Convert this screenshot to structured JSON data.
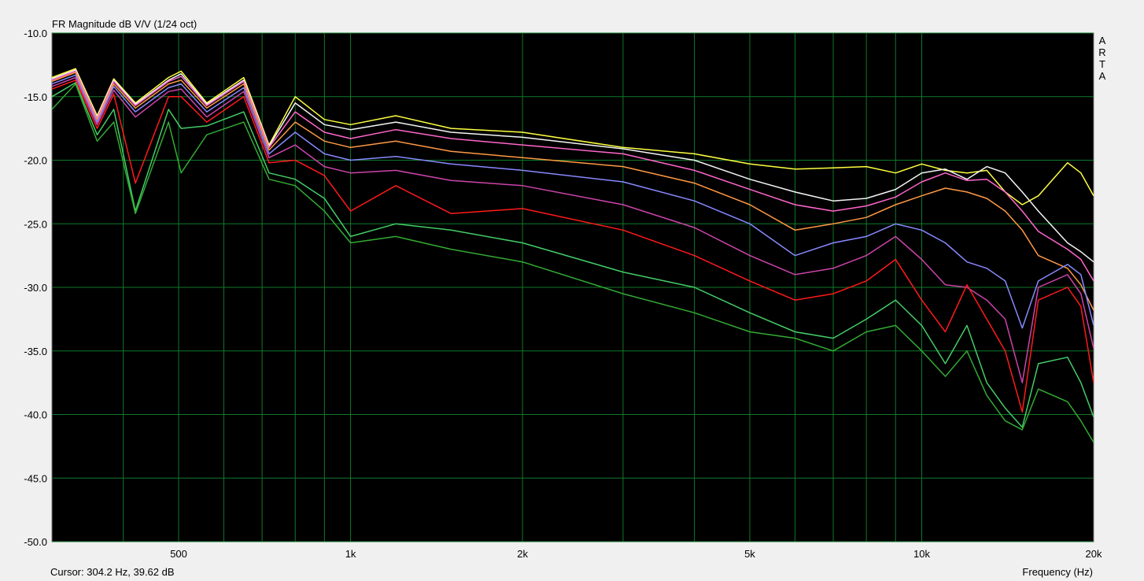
{
  "chart_data": {
    "type": "line",
    "title": "FR Magnitude dB V/V (1/24 oct)",
    "xlabel": "Frequency (Hz)",
    "ylabel": "",
    "x_scale": "log",
    "xlim": [
      300,
      20000
    ],
    "ylim": [
      -50,
      -10
    ],
    "grid": true,
    "y_ticks": [
      "-10.0",
      "-15.0",
      "-20.0",
      "-25.0",
      "-30.0",
      "-35.0",
      "-40.0",
      "-45.0",
      "-50.0"
    ],
    "x_tick_labels": [
      {
        "value": 500,
        "label": "500"
      },
      {
        "value": 1000,
        "label": "1k"
      },
      {
        "value": 2000,
        "label": "2k"
      },
      {
        "value": 5000,
        "label": "5k"
      },
      {
        "value": 10000,
        "label": "10k"
      },
      {
        "value": 20000,
        "label": "20k"
      }
    ],
    "x_minor_grid": [
      400,
      500,
      600,
      700,
      800,
      900,
      1000,
      2000,
      3000,
      4000,
      5000,
      6000,
      7000,
      8000,
      9000,
      10000
    ],
    "brand": [
      "A",
      "R",
      "T",
      "A"
    ],
    "cursor": "Cursor: 304.2 Hz, 39.62 dB",
    "series": [
      {
        "color": "#ffff40",
        "points": [
          [
            300,
            -13.5
          ],
          [
            330,
            -12.8
          ],
          [
            360,
            -16.5
          ],
          [
            385,
            -13.6
          ],
          [
            420,
            -15.5
          ],
          [
            480,
            -13.5
          ],
          [
            505,
            -13.0
          ],
          [
            560,
            -15.5
          ],
          [
            650,
            -13.5
          ],
          [
            720,
            -18.8
          ],
          [
            800,
            -15.0
          ],
          [
            900,
            -16.8
          ],
          [
            1000,
            -17.2
          ],
          [
            1200,
            -16.5
          ],
          [
            1500,
            -17.5
          ],
          [
            2000,
            -17.8
          ],
          [
            3000,
            -19.0
          ],
          [
            4000,
            -19.5
          ],
          [
            5000,
            -20.3
          ],
          [
            6000,
            -20.7
          ],
          [
            7000,
            -20.6
          ],
          [
            8000,
            -20.5
          ],
          [
            9000,
            -21.0
          ],
          [
            10000,
            -20.3
          ],
          [
            11000,
            -20.8
          ],
          [
            12000,
            -21.0
          ],
          [
            13000,
            -20.8
          ],
          [
            14000,
            -22.5
          ],
          [
            15000,
            -23.5
          ],
          [
            16000,
            -22.8
          ],
          [
            18000,
            -20.2
          ],
          [
            19000,
            -21.0
          ],
          [
            20000,
            -22.8
          ]
        ]
      },
      {
        "color": "#f5f5f5",
        "points": [
          [
            300,
            -13.6
          ],
          [
            330,
            -12.9
          ],
          [
            360,
            -16.6
          ],
          [
            385,
            -13.7
          ],
          [
            420,
            -15.6
          ],
          [
            480,
            -13.7
          ],
          [
            505,
            -13.2
          ],
          [
            560,
            -15.6
          ],
          [
            650,
            -13.7
          ],
          [
            720,
            -18.9
          ],
          [
            800,
            -15.5
          ],
          [
            900,
            -17.2
          ],
          [
            1000,
            -17.6
          ],
          [
            1200,
            -17.0
          ],
          [
            1500,
            -17.8
          ],
          [
            2000,
            -18.2
          ],
          [
            3000,
            -19.1
          ],
          [
            4000,
            -20.0
          ],
          [
            5000,
            -21.5
          ],
          [
            6000,
            -22.5
          ],
          [
            7000,
            -23.2
          ],
          [
            8000,
            -23.0
          ],
          [
            9000,
            -22.3
          ],
          [
            10000,
            -21.0
          ],
          [
            11000,
            -20.7
          ],
          [
            12000,
            -21.5
          ],
          [
            13000,
            -20.5
          ],
          [
            14000,
            -21.0
          ],
          [
            15000,
            -22.5
          ],
          [
            16000,
            -24.0
          ],
          [
            18000,
            -26.5
          ],
          [
            19000,
            -27.2
          ],
          [
            20000,
            -28.0
          ]
        ]
      },
      {
        "color": "#ff66cc",
        "points": [
          [
            300,
            -13.7
          ],
          [
            330,
            -13.0
          ],
          [
            360,
            -16.7
          ],
          [
            385,
            -13.8
          ],
          [
            420,
            -15.7
          ],
          [
            480,
            -13.8
          ],
          [
            505,
            -13.4
          ],
          [
            560,
            -15.7
          ],
          [
            650,
            -13.8
          ],
          [
            720,
            -19.0
          ],
          [
            800,
            -16.2
          ],
          [
            900,
            -17.8
          ],
          [
            1000,
            -18.3
          ],
          [
            1200,
            -17.6
          ],
          [
            1500,
            -18.3
          ],
          [
            2000,
            -18.8
          ],
          [
            3000,
            -19.5
          ],
          [
            4000,
            -20.8
          ],
          [
            5000,
            -22.3
          ],
          [
            6000,
            -23.5
          ],
          [
            7000,
            -24.0
          ],
          [
            8000,
            -23.6
          ],
          [
            9000,
            -22.9
          ],
          [
            10000,
            -21.7
          ],
          [
            11000,
            -21.0
          ],
          [
            12000,
            -21.6
          ],
          [
            13000,
            -21.5
          ],
          [
            14000,
            -22.5
          ],
          [
            15000,
            -24.0
          ],
          [
            16000,
            -25.6
          ],
          [
            18000,
            -27.0
          ],
          [
            19000,
            -27.8
          ],
          [
            20000,
            -29.5
          ]
        ]
      },
      {
        "color": "#ff9944",
        "points": [
          [
            300,
            -13.8
          ],
          [
            330,
            -13.1
          ],
          [
            360,
            -16.8
          ],
          [
            385,
            -14.0
          ],
          [
            420,
            -15.9
          ],
          [
            480,
            -14.0
          ],
          [
            505,
            -13.7
          ],
          [
            560,
            -15.9
          ],
          [
            650,
            -14.0
          ],
          [
            720,
            -19.2
          ],
          [
            800,
            -17.0
          ],
          [
            900,
            -18.5
          ],
          [
            1000,
            -19.0
          ],
          [
            1200,
            -18.5
          ],
          [
            1500,
            -19.3
          ],
          [
            2000,
            -19.8
          ],
          [
            3000,
            -20.5
          ],
          [
            4000,
            -21.8
          ],
          [
            5000,
            -23.5
          ],
          [
            6000,
            -25.5
          ],
          [
            7000,
            -25.0
          ],
          [
            8000,
            -24.5
          ],
          [
            9000,
            -23.5
          ],
          [
            10000,
            -22.8
          ],
          [
            11000,
            -22.2
          ],
          [
            12000,
            -22.5
          ],
          [
            13000,
            -23.0
          ],
          [
            14000,
            -24.0
          ],
          [
            15000,
            -25.5
          ],
          [
            16000,
            -27.5
          ],
          [
            18000,
            -28.5
          ],
          [
            19000,
            -29.8
          ],
          [
            20000,
            -31.8
          ]
        ]
      },
      {
        "color": "#8888ff",
        "points": [
          [
            300,
            -14.0
          ],
          [
            330,
            -13.3
          ],
          [
            360,
            -17.0
          ],
          [
            385,
            -14.2
          ],
          [
            420,
            -16.2
          ],
          [
            480,
            -14.3
          ],
          [
            505,
            -14.0
          ],
          [
            560,
            -16.2
          ],
          [
            650,
            -14.3
          ],
          [
            720,
            -19.5
          ],
          [
            800,
            -17.8
          ],
          [
            900,
            -19.5
          ],
          [
            1000,
            -20.0
          ],
          [
            1200,
            -19.7
          ],
          [
            1500,
            -20.3
          ],
          [
            2000,
            -20.8
          ],
          [
            3000,
            -21.7
          ],
          [
            4000,
            -23.2
          ],
          [
            5000,
            -25.0
          ],
          [
            6000,
            -27.5
          ],
          [
            7000,
            -26.5
          ],
          [
            8000,
            -26.0
          ],
          [
            9000,
            -25.0
          ],
          [
            10000,
            -25.5
          ],
          [
            11000,
            -26.5
          ],
          [
            12000,
            -28.0
          ],
          [
            13000,
            -28.5
          ],
          [
            14000,
            -29.5
          ],
          [
            15000,
            -33.2
          ],
          [
            16000,
            -29.5
          ],
          [
            18000,
            -28.2
          ],
          [
            19000,
            -29.0
          ],
          [
            20000,
            -33.0
          ]
        ]
      },
      {
        "color": "#cc44aa",
        "points": [
          [
            300,
            -14.2
          ],
          [
            330,
            -13.5
          ],
          [
            360,
            -17.2
          ],
          [
            385,
            -14.5
          ],
          [
            420,
            -16.6
          ],
          [
            480,
            -14.6
          ],
          [
            505,
            -14.4
          ],
          [
            560,
            -16.6
          ],
          [
            650,
            -14.6
          ],
          [
            720,
            -19.8
          ],
          [
            800,
            -18.8
          ],
          [
            900,
            -20.5
          ],
          [
            1000,
            -21.0
          ],
          [
            1200,
            -20.8
          ],
          [
            1500,
            -21.6
          ],
          [
            2000,
            -22.0
          ],
          [
            3000,
            -23.5
          ],
          [
            4000,
            -25.3
          ],
          [
            5000,
            -27.5
          ],
          [
            6000,
            -29.0
          ],
          [
            7000,
            -28.5
          ],
          [
            8000,
            -27.5
          ],
          [
            9000,
            -26.0
          ],
          [
            10000,
            -27.8
          ],
          [
            11000,
            -29.8
          ],
          [
            12000,
            -30.0
          ],
          [
            13000,
            -31.0
          ],
          [
            14000,
            -32.5
          ],
          [
            15000,
            -37.5
          ],
          [
            16000,
            -30.0
          ],
          [
            18000,
            -29.0
          ],
          [
            19000,
            -30.5
          ],
          [
            20000,
            -34.8
          ]
        ]
      },
      {
        "color": "#ff1a1a",
        "points": [
          [
            300,
            -14.4
          ],
          [
            330,
            -13.7
          ],
          [
            360,
            -17.5
          ],
          [
            385,
            -14.8
          ],
          [
            420,
            -21.8
          ],
          [
            480,
            -15.0
          ],
          [
            505,
            -15.0
          ],
          [
            560,
            -17.0
          ],
          [
            650,
            -15.0
          ],
          [
            720,
            -20.2
          ],
          [
            800,
            -20.0
          ],
          [
            900,
            -21.2
          ],
          [
            1000,
            -24.0
          ],
          [
            1200,
            -22.0
          ],
          [
            1500,
            -24.2
          ],
          [
            2000,
            -23.8
          ],
          [
            3000,
            -25.5
          ],
          [
            4000,
            -27.5
          ],
          [
            5000,
            -29.5
          ],
          [
            6000,
            -31.0
          ],
          [
            7000,
            -30.5
          ],
          [
            8000,
            -29.5
          ],
          [
            9000,
            -27.8
          ],
          [
            10000,
            -31.0
          ],
          [
            11000,
            -33.5
          ],
          [
            12000,
            -29.8
          ],
          [
            13000,
            -32.5
          ],
          [
            14000,
            -35.0
          ],
          [
            15000,
            -39.8
          ],
          [
            16000,
            -31.0
          ],
          [
            18000,
            -30.0
          ],
          [
            19000,
            -31.5
          ],
          [
            20000,
            -37.5
          ]
        ]
      },
      {
        "color": "#44cc66",
        "points": [
          [
            300,
            -15.0
          ],
          [
            330,
            -13.9
          ],
          [
            360,
            -18.0
          ],
          [
            385,
            -16.0
          ],
          [
            420,
            -24.0
          ],
          [
            480,
            -16.0
          ],
          [
            505,
            -17.5
          ],
          [
            560,
            -17.3
          ],
          [
            650,
            -16.2
          ],
          [
            720,
            -21.0
          ],
          [
            800,
            -21.5
          ],
          [
            900,
            -23.0
          ],
          [
            1000,
            -26.0
          ],
          [
            1200,
            -25.0
          ],
          [
            1500,
            -25.5
          ],
          [
            2000,
            -26.5
          ],
          [
            3000,
            -28.8
          ],
          [
            4000,
            -30.0
          ],
          [
            5000,
            -32.0
          ],
          [
            6000,
            -33.5
          ],
          [
            7000,
            -34.0
          ],
          [
            8000,
            -32.5
          ],
          [
            9000,
            -31.0
          ],
          [
            10000,
            -33.0
          ],
          [
            11000,
            -36.0
          ],
          [
            12000,
            -33.0
          ],
          [
            13000,
            -37.5
          ],
          [
            14000,
            -39.5
          ],
          [
            15000,
            -41.0
          ],
          [
            16000,
            -36.0
          ],
          [
            18000,
            -35.5
          ],
          [
            19000,
            -37.5
          ],
          [
            20000,
            -40.2
          ]
        ]
      },
      {
        "color": "#33aa33",
        "points": [
          [
            300,
            -16.0
          ],
          [
            330,
            -14.0
          ],
          [
            360,
            -18.5
          ],
          [
            385,
            -17.0
          ],
          [
            420,
            -24.2
          ],
          [
            480,
            -17.0
          ],
          [
            505,
            -21.0
          ],
          [
            560,
            -18.0
          ],
          [
            650,
            -17.0
          ],
          [
            720,
            -21.5
          ],
          [
            800,
            -22.0
          ],
          [
            900,
            -24.0
          ],
          [
            1000,
            -26.5
          ],
          [
            1200,
            -26.0
          ],
          [
            1500,
            -27.0
          ],
          [
            2000,
            -28.0
          ],
          [
            3000,
            -30.5
          ],
          [
            4000,
            -32.0
          ],
          [
            5000,
            -33.5
          ],
          [
            6000,
            -34.0
          ],
          [
            7000,
            -35.0
          ],
          [
            8000,
            -33.5
          ],
          [
            9000,
            -33.0
          ],
          [
            10000,
            -35.0
          ],
          [
            11000,
            -37.0
          ],
          [
            12000,
            -35.0
          ],
          [
            13000,
            -38.5
          ],
          [
            14000,
            -40.5
          ],
          [
            15000,
            -41.2
          ],
          [
            16000,
            -38.0
          ],
          [
            18000,
            -39.0
          ],
          [
            19000,
            -40.5
          ],
          [
            20000,
            -42.2
          ]
        ]
      }
    ]
  }
}
